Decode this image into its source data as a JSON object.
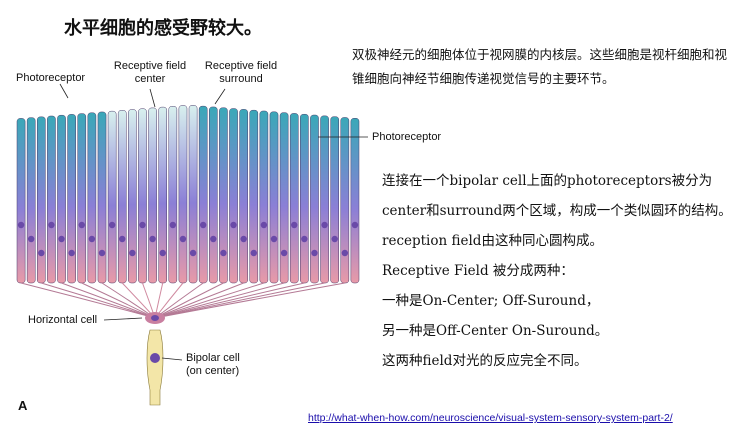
{
  "title": "水平细胞的感受野较大。",
  "intro": "双极神经元的细胞体位于视网膜的内核层。这些细胞是视杆细胞和视锥细胞向神经节细胞传递视觉信号的主要环节。",
  "paragraphs": [
    "连接在一个bipolar cell上面的photoreceptors被分为center和surround两个区域，构成一个类似圆环的结构。reception field由这种同心圆构成。",
    "Receptive Field 被分成两种：",
    "一种是On-Center; Off-Suround，",
    "另一种是Off-Center On-Suround。",
    "这两种field对光的反应完全不同。"
  ],
  "figure": {
    "labels": {
      "photoreceptor_left": "Photoreceptor",
      "rf_center_line1": "Receptive field",
      "rf_center_line2": "center",
      "rf_surround_line1": "Receptive field",
      "rf_surround_line2": "surround",
      "photoreceptor_right": "Photoreceptor",
      "horizontal_cell": "Horizontal cell",
      "bipolar_line1": "Bipolar cell",
      "bipolar_line2": "(on center)",
      "panel": "A"
    },
    "colors": {
      "surround_top": "#3aa8b8",
      "center_top": "#d8f0ee",
      "middle": "#8b7fd6",
      "bottom": "#e89aa8",
      "nucleus": "#6a4aa8",
      "bipolar": "#f3e6a8",
      "horizontal": "#c97fa0"
    }
  },
  "source_link": "http://what-when-how.com/neuroscience/visual-system-sensory-system-part-2/"
}
